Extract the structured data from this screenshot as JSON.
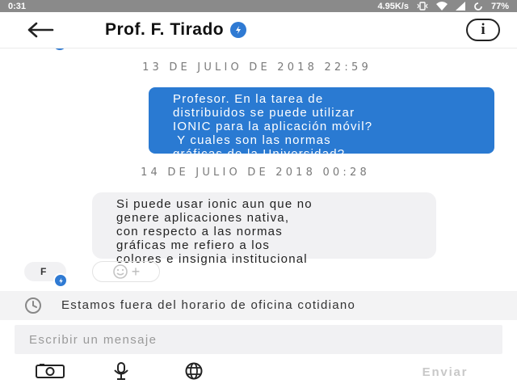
{
  "status_bar": {
    "time": "0:31",
    "network_speed": "4.95K/s",
    "battery": "77%"
  },
  "header": {
    "title": "Prof. F. Tirado",
    "verified": true,
    "back_icon": "arrow-left-icon",
    "info_label": "i"
  },
  "chat": {
    "messages": [
      {
        "date_separator": "13 DE JULIO DE 2018 22:59",
        "direction": "outgoing",
        "lines": [
          "Profesor. En la tarea de",
          "distribuidos se puede utilizar",
          "IONIC para la aplicación móvil?",
          " Y cuales son las normas",
          "gráficas de la Universidad?"
        ]
      },
      {
        "date_separator": "14 DE JULIO DE 2018 00:28",
        "direction": "incoming",
        "sender_initial": "F",
        "lines": [
          "Si puede usar ionic aun que no",
          "genere aplicaciones nativa,",
          "con respecto a las normas",
          "gráficas me refiero a los",
          "colores e insignia institucional"
        ]
      }
    ],
    "reaction_add": "+"
  },
  "notice": {
    "icon": "clock-icon",
    "text": "Estamos fuera del horario de oficina cotidiano"
  },
  "composer": {
    "placeholder": "Escribir un mensaje",
    "send_label": "Enviar",
    "tools": [
      "camera-icon",
      "microphone-icon",
      "globe-icon"
    ]
  },
  "colors": {
    "accent": "#2a7ad2",
    "bubble_incoming": "#f1f1f3",
    "status_bar": "#8a8a8a"
  }
}
